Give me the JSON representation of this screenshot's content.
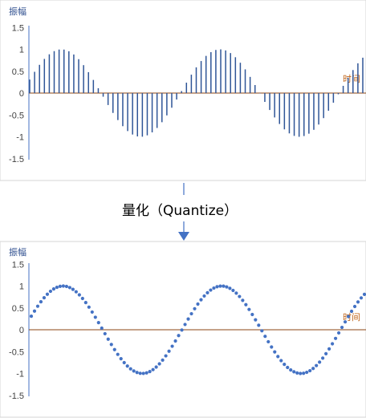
{
  "diagram": {
    "step_label": "量化（Quantize）",
    "arrow_color": "#4472c4"
  },
  "chart_data": [
    {
      "type": "bar",
      "name": "sampled",
      "ylabel": "振幅",
      "xlabel": "时间",
      "ylim": [
        -1.5,
        1.5
      ],
      "yticks": [
        "1.5",
        "1",
        "0.5",
        "0",
        "-0.5",
        "-1",
        "-1.5"
      ],
      "ytick_values": [
        1.5,
        1,
        0.5,
        0,
        -0.5,
        -1,
        -1.5
      ],
      "series_color": "#2f5597",
      "zero_line_color": "#8b4513",
      "function": "sine",
      "sample_count": 69,
      "cycles": 2.1,
      "phase": 0.05
    },
    {
      "type": "scatter",
      "name": "quantized",
      "ylabel": "振幅",
      "xlabel": "时间",
      "ylim": [
        -1.5,
        1.5
      ],
      "yticks": [
        "1.5",
        "1",
        "0.5",
        "0",
        "-0.5",
        "-1",
        "-1.5"
      ],
      "ytick_values": [
        1.5,
        1,
        0.5,
        0,
        -0.5,
        -1,
        -1.5
      ],
      "series_color": "#4472c4",
      "zero_line_color": "#8b4513",
      "function": "sine",
      "sample_count": 105,
      "cycles": 2.1,
      "phase": 0.05
    }
  ]
}
